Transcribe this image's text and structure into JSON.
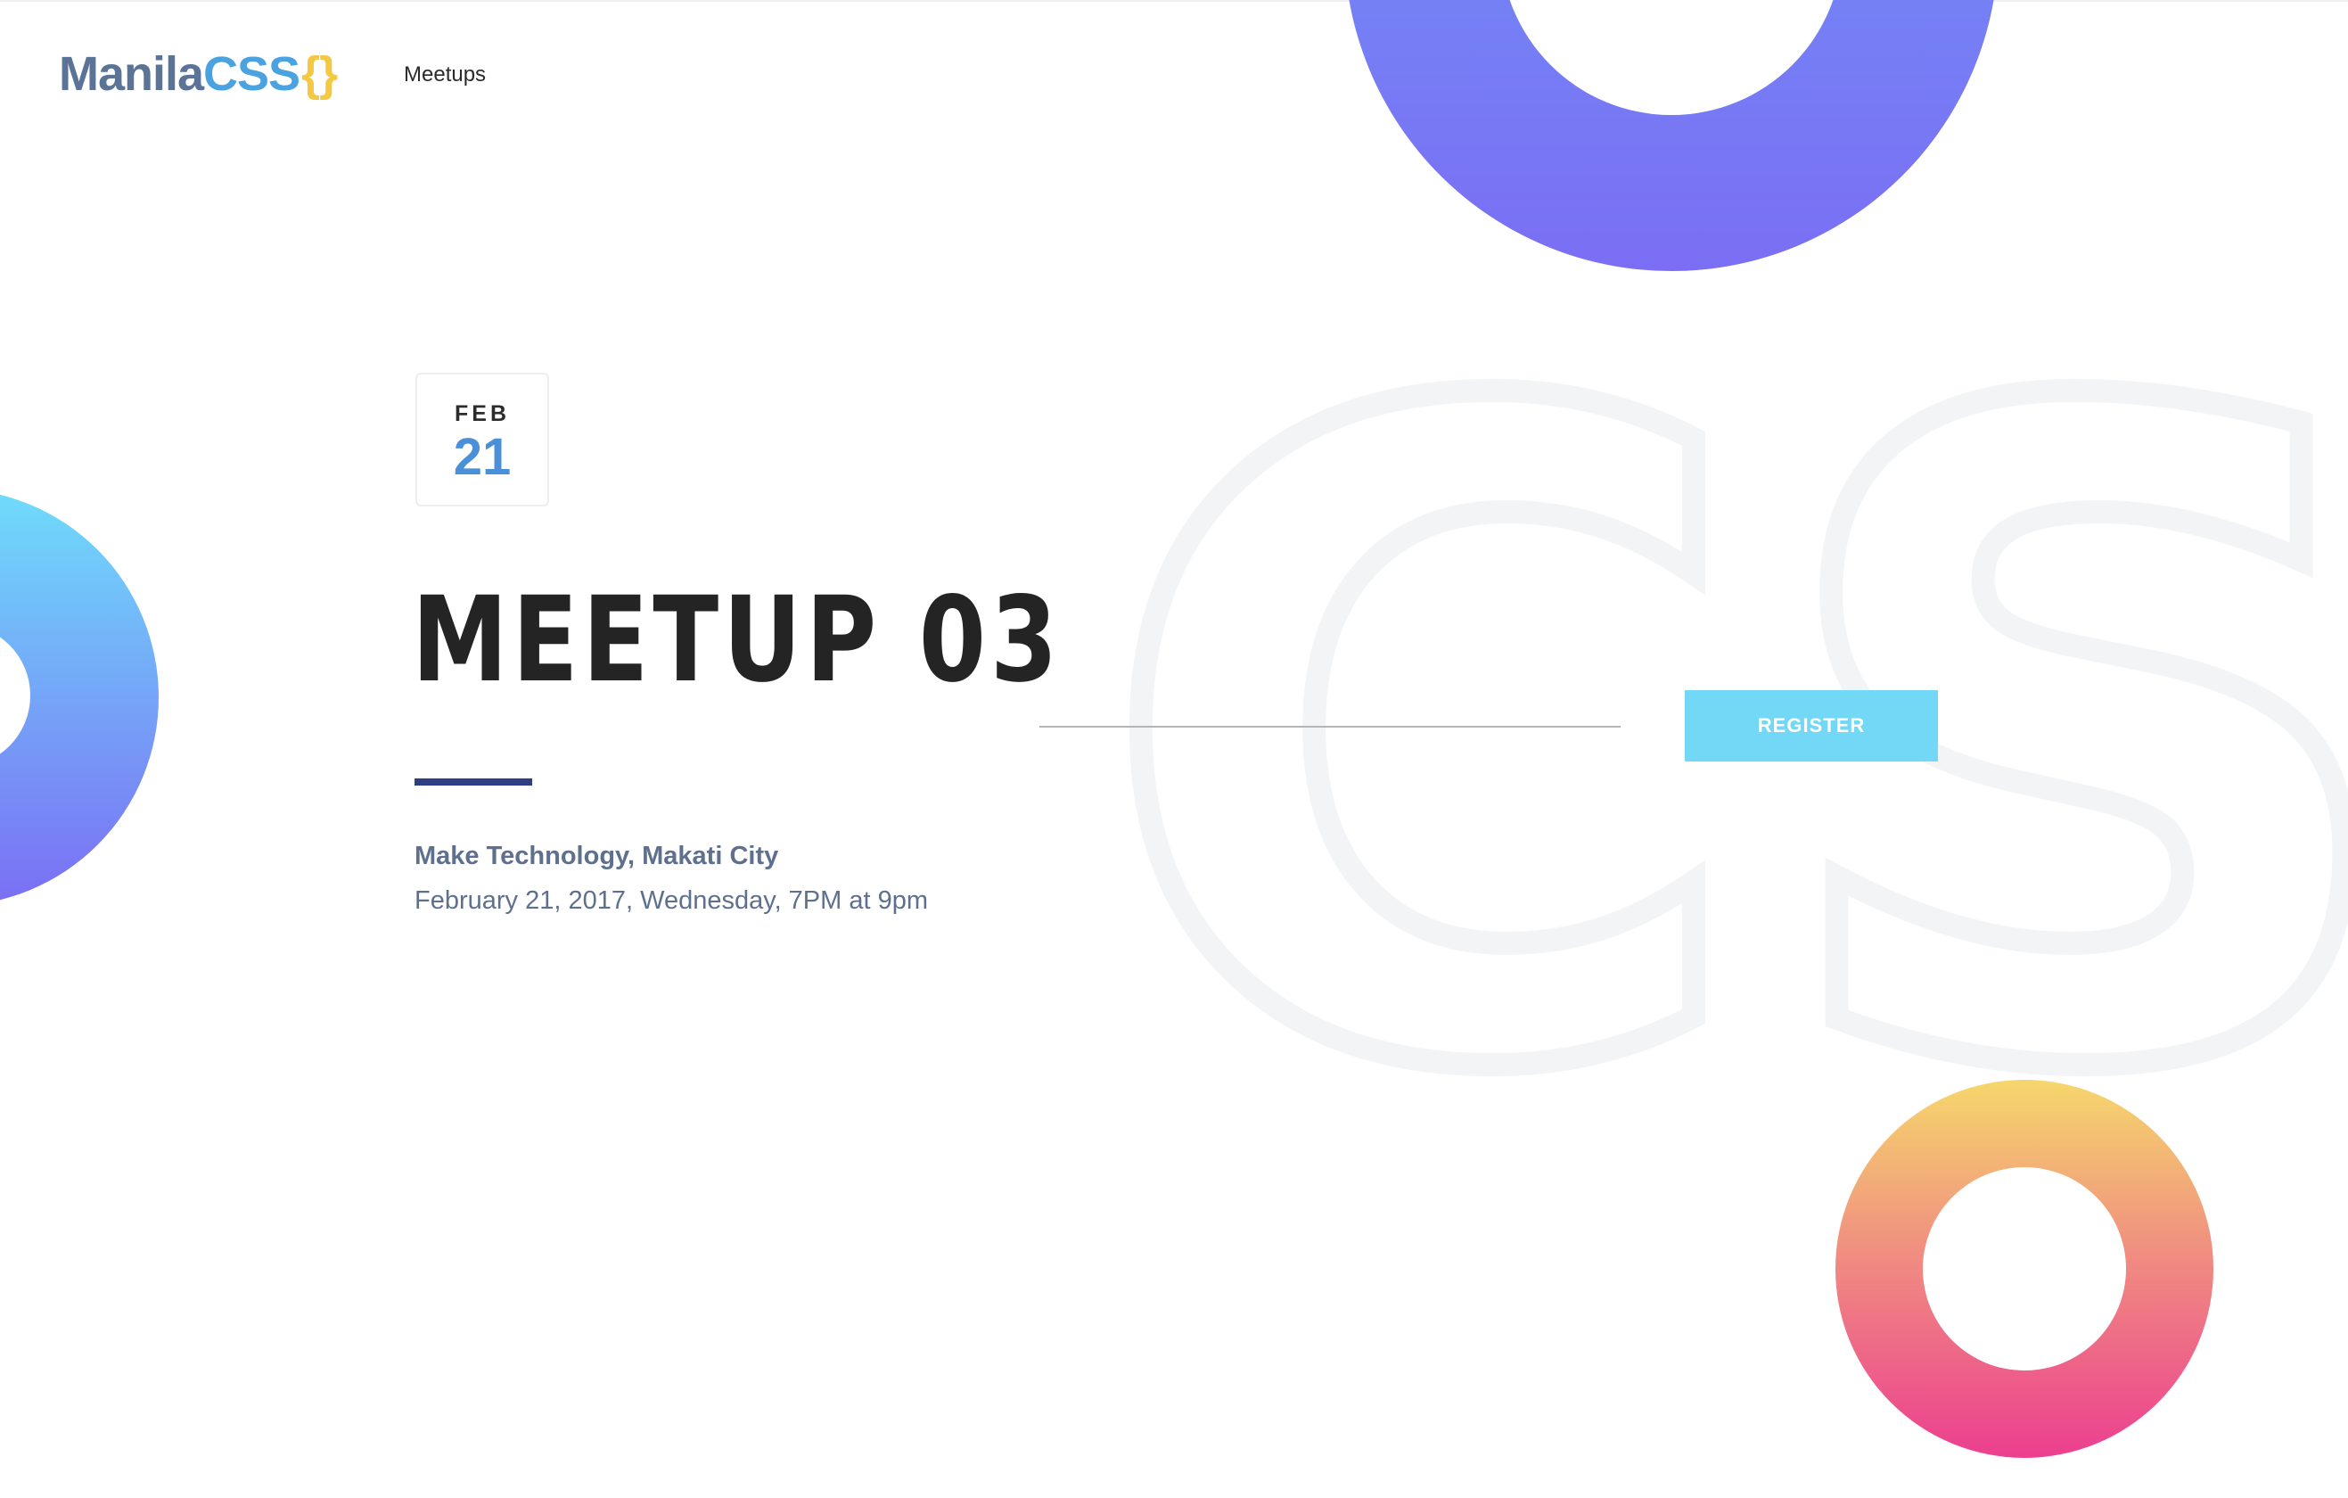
{
  "header": {
    "logo": {
      "part1": "Manila",
      "part2": "CSS",
      "part3": "{}"
    },
    "nav": [
      {
        "label": "Meetups"
      }
    ]
  },
  "event": {
    "date": {
      "month": "FEB",
      "day": "21"
    },
    "title": "MEETUP 03",
    "venue": "Make Technology, Makati City",
    "datetime": "February 21, 2017, Wednesday, 7PM at 9pm"
  },
  "register": {
    "email_value": "",
    "button_label": "REGISTER"
  },
  "background": {
    "watermark_text": "CSS"
  },
  "colors": {
    "logo_manila": "#5b7396",
    "logo_css": "#4aa3e0",
    "logo_brace": "#f5c842",
    "date_day": "#4a90d9",
    "title": "#242424",
    "underline": "#2d3e82",
    "register_button": "#72d8f6",
    "meta_text": "#5e708e"
  }
}
